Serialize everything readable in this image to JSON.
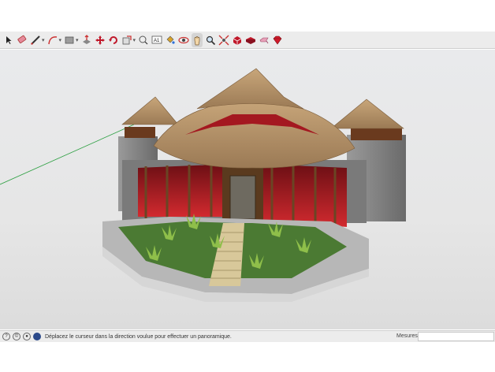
{
  "toolbar": {
    "tools": [
      "select-icon",
      "eraser-icon",
      "pencil-line-icon",
      "arc-icon",
      "rectangle-icon",
      "push-pull-icon",
      "move-icon",
      "rotate-icon",
      "scale-icon",
      "tape-measure-icon",
      "text-icon",
      "paint-bucket-icon",
      "orbit-icon",
      "pan-icon",
      "zoom-icon",
      "zoom-extents-icon",
      "3d-warehouse-icon",
      "extension-warehouse-icon",
      "layout-icon",
      "ruby-icon"
    ],
    "active_tool": "pan-icon"
  },
  "statusbar": {
    "message": "Déplacez le curseur dans la direction voulue pour effectuer un panoramique.",
    "measurements_label": "Mesures",
    "measurements_value": ""
  },
  "colors": {
    "thatch": "#b8956a",
    "glass_red": "#b3121b",
    "stone": "#8a8a8a",
    "grass": "#3f6a2a",
    "green_axis": "#2ea043"
  }
}
